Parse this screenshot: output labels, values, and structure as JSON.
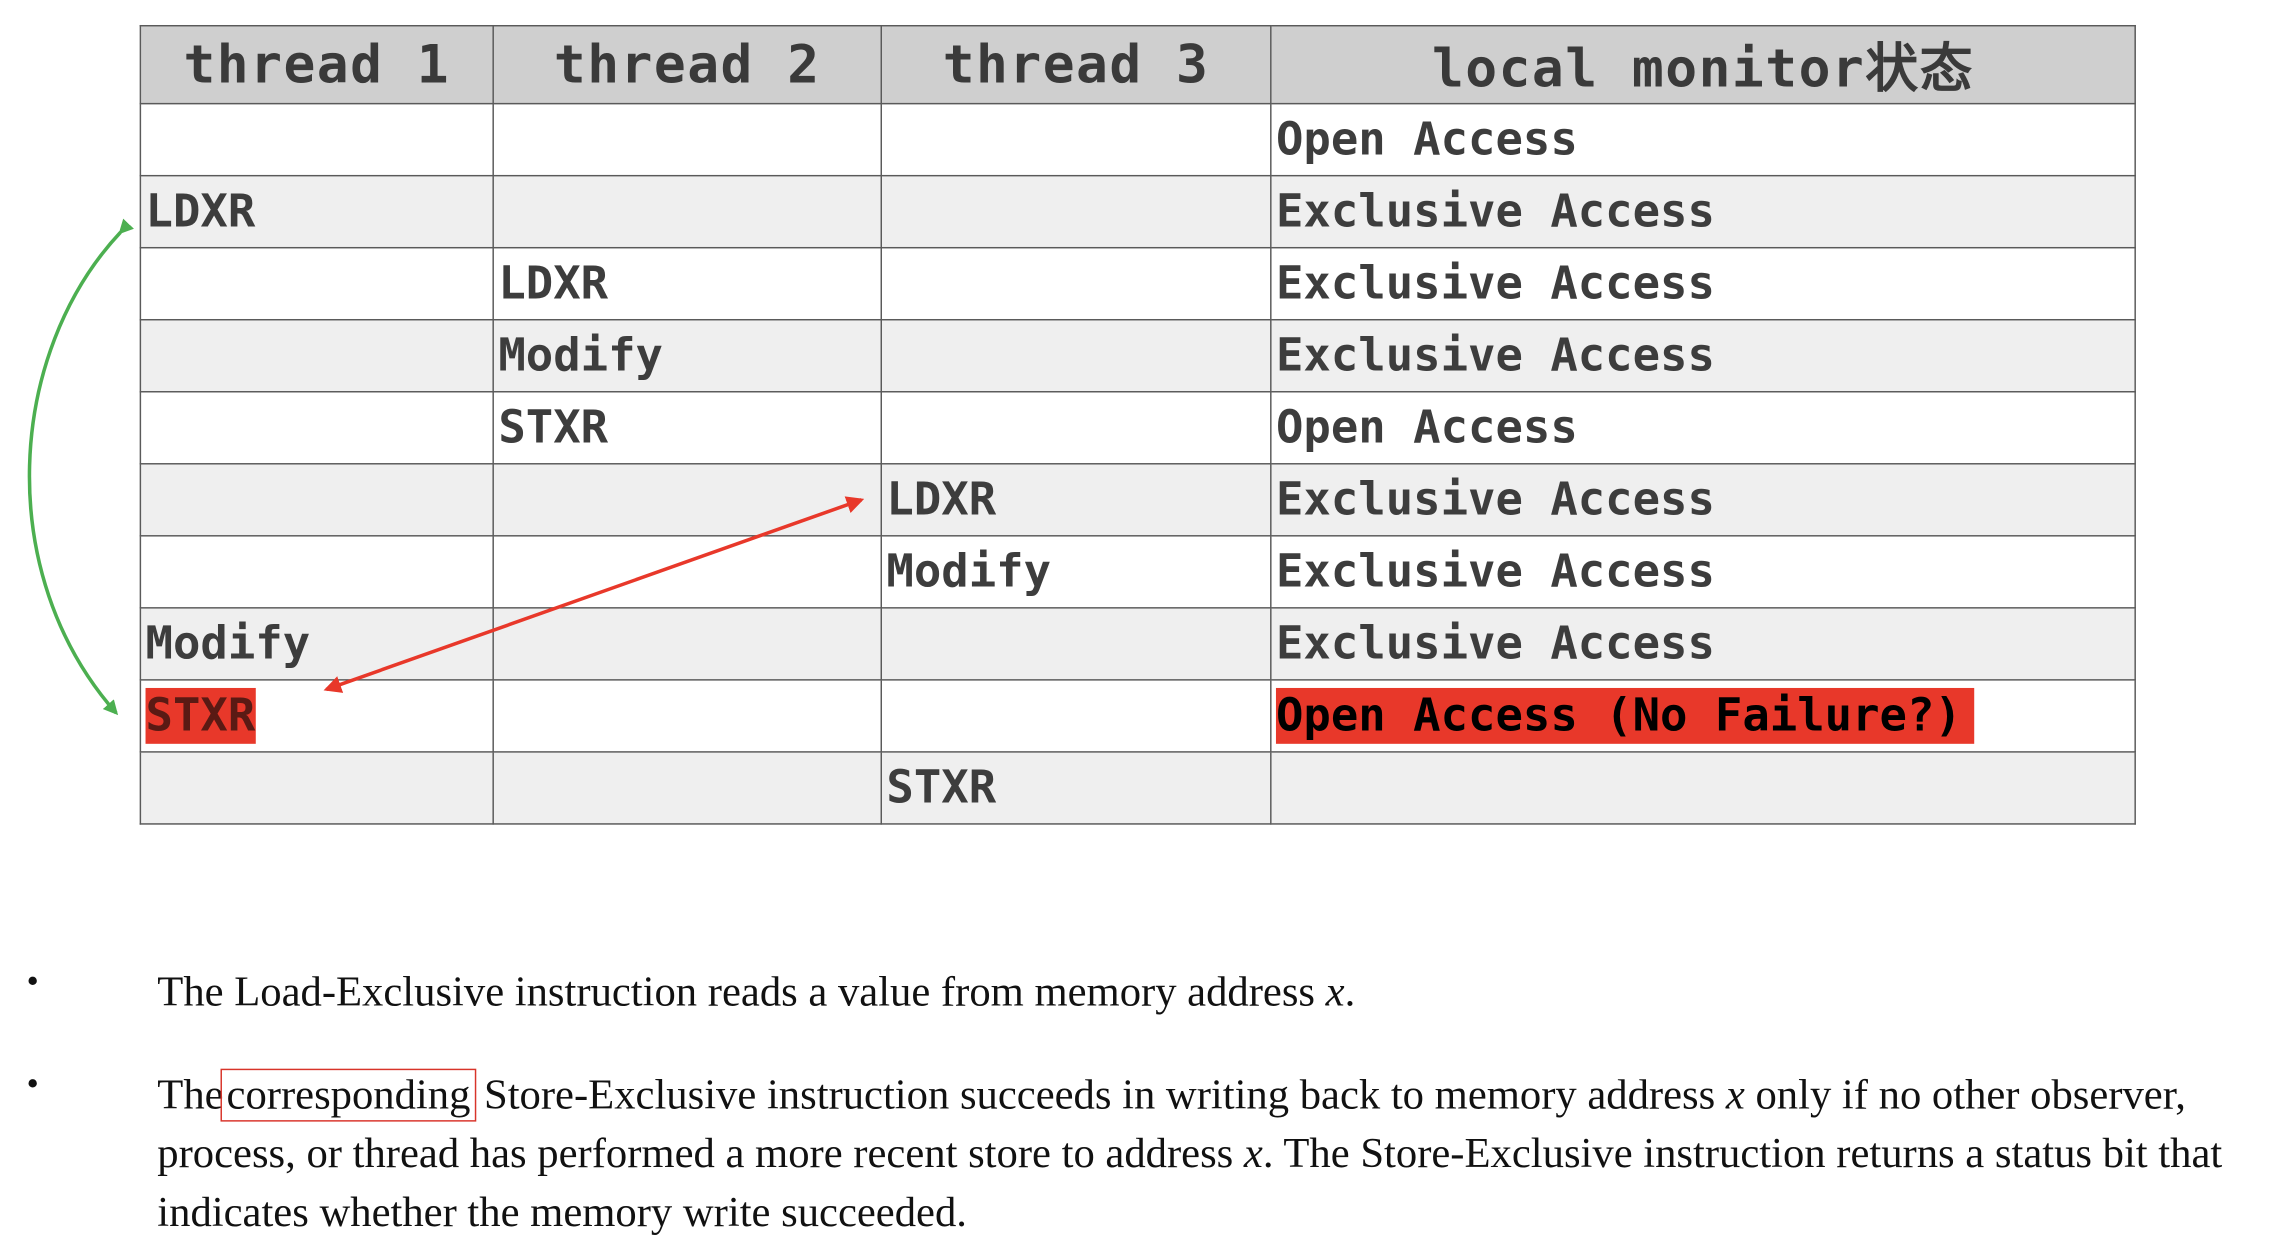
{
  "table": {
    "headers": [
      "thread 1",
      "thread 2",
      "thread 3",
      "local monitor状态"
    ],
    "rows": [
      [
        "",
        "",
        "",
        "Open Access"
      ],
      [
        "LDXR",
        "",
        "",
        "Exclusive Access"
      ],
      [
        "",
        "LDXR",
        "",
        "Exclusive Access"
      ],
      [
        "",
        "Modify",
        "",
        "Exclusive Access"
      ],
      [
        "",
        "STXR",
        "",
        "Open Access"
      ],
      [
        "",
        "",
        "LDXR",
        "Exclusive Access"
      ],
      [
        "",
        "",
        "Modify",
        "Exclusive Access"
      ],
      [
        "Modify",
        "",
        "",
        "Exclusive Access"
      ],
      [
        "STXR",
        "",
        "",
        "Open Access (No Failure?)"
      ],
      [
        "",
        "",
        "STXR",
        ""
      ]
    ]
  },
  "bullets": {
    "b1": {
      "dot": "•",
      "text_before": "The Load-Exclusive instruction reads a value from memory address ",
      "var": "x",
      "text_after": "."
    },
    "b2": {
      "dot": "•",
      "the": "The",
      "boxed": "corresponding",
      "part1": " Store-Exclusive instruction succeeds in writing back to memory address ",
      "var1": "x",
      "part2": " only if no other observer, process, or thread has performed a more recent store to address ",
      "var2": "x",
      "part3": ". The Store-Exclusive instruction returns a status bit that indicates whether the memory write succeeded."
    }
  },
  "colors": {
    "green_arrow": "#4caf50",
    "red_arrow": "#e8382a",
    "highlight": "#e8382a"
  }
}
